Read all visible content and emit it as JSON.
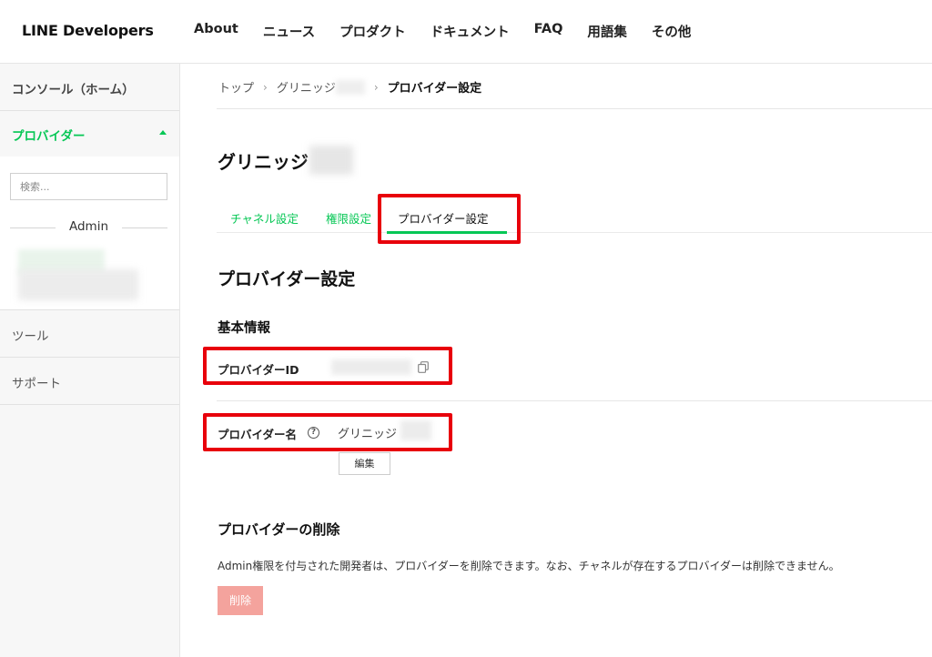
{
  "header": {
    "logo": "LINE Developers",
    "nav": [
      "About",
      "ニュース",
      "プロダクト",
      "ドキュメント",
      "FAQ",
      "用語集",
      "その他"
    ]
  },
  "sidebar": {
    "home": "コンソール（ホーム）",
    "provider": "プロバイダー",
    "search_placeholder": "検索...",
    "admin_label": "Admin",
    "tools": "ツール",
    "support": "サポート"
  },
  "breadcrumb": {
    "top": "トップ",
    "provider": "グリニッジ",
    "current": "プロバイダー設定"
  },
  "page": {
    "title": "グリニッジ",
    "tabs": [
      "チャネル設定",
      "権限設定",
      "プロバイダー設定"
    ],
    "section_title": "プロバイダー設定",
    "basic_info": "基本情報",
    "provider_id_label": "プロバイダーID",
    "provider_name_label": "プロバイダー名",
    "provider_name_value": "グリニッジ",
    "edit_button": "編集",
    "delete_title": "プロバイダーの削除",
    "delete_text": "Admin権限を付与された開発者は、プロバイダーを削除できます。なお、チャネルが存在するプロバイダーは削除できません。",
    "delete_button": "削除"
  },
  "colors": {
    "accent": "#06c755",
    "highlight": "#e8000b",
    "delete_button": "#f4a39d"
  }
}
